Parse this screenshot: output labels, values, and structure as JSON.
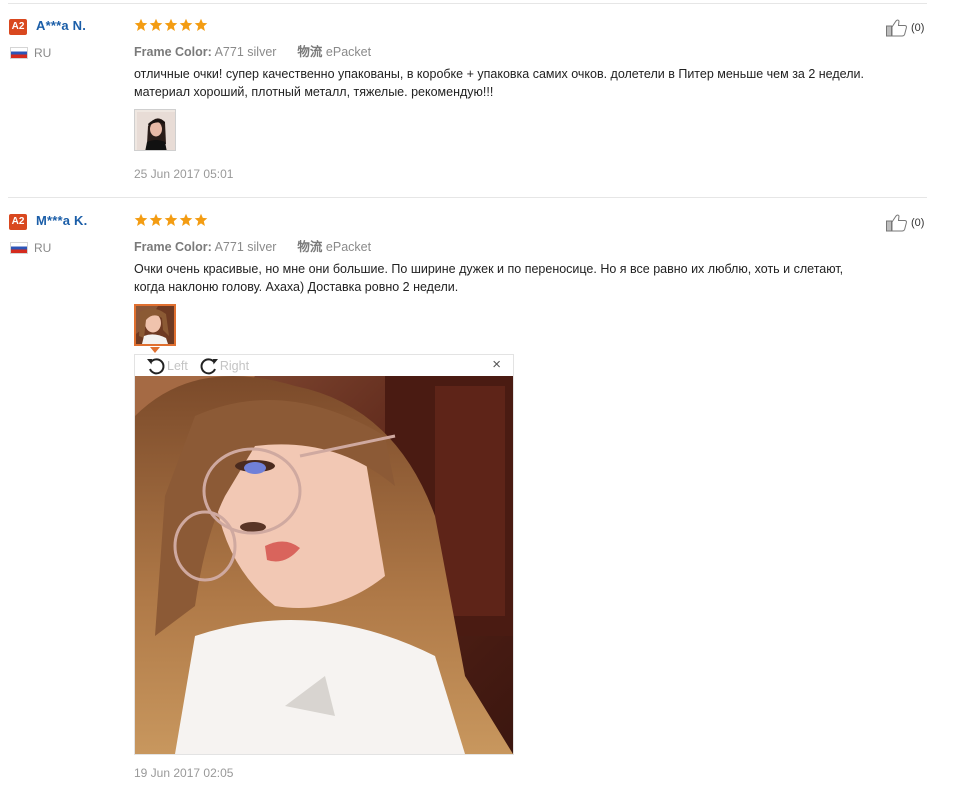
{
  "reviews": [
    {
      "level": "A2",
      "name": "A***a N.",
      "country": "RU",
      "rating": 5,
      "frame_color_label": "Frame Color:",
      "frame_color_value": "A771 silver",
      "shipping_label": "物流",
      "shipping_value": "ePacket",
      "text_line1": "отличные очки! супер качественно упакованы, в коробке + упаковка самих очков. долетели в Питер меньше чем за 2 недели.",
      "text_line2": "материал хороший, плотный металл, тяжелые. рекомендую!!!",
      "date": "25 Jun 2017 05:01",
      "helpful_count": "(0)"
    },
    {
      "level": "A2",
      "name": "M***a K.",
      "country": "RU",
      "rating": 5,
      "frame_color_label": "Frame Color:",
      "frame_color_value": "A771 silver",
      "shipping_label": "物流",
      "shipping_value": "ePacket",
      "text_line1": "Очки очень красивые, но мне они большие. По ширине дужек и по переносице. Но я все равно их люблю, хоть и слетают,",
      "text_line2": "когда наклоню голову. Ахаха) Доставка ровно 2 недели.",
      "date": "19 Jun 2017 02:05",
      "helpful_count": "(0)"
    }
  ],
  "viewer": {
    "rotate_left_label": "Left",
    "rotate_right_label": "Right",
    "close_label": "×"
  },
  "colors": {
    "star": "#f39c12",
    "name": "#1b5ea8",
    "badge": "#d9481f",
    "selected_thumb": "#e07030"
  }
}
